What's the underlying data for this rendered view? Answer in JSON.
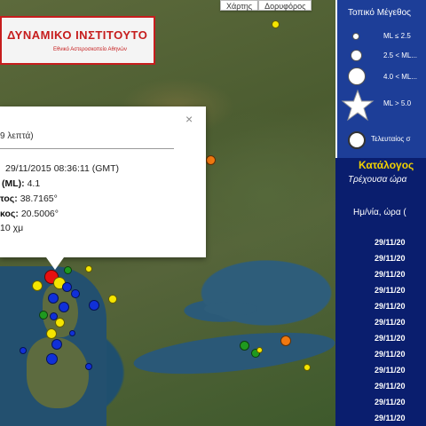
{
  "map": {
    "tabs": [
      {
        "label": "Χάρτης"
      },
      {
        "label": "Δορυφόρος"
      }
    ]
  },
  "logo": {
    "title": "ΔΥΝΑΜΙΚΟ ΙΝΣΤΙΤΟΥΤΟ",
    "subtitle": "Εθνικό Αστεροσκοπείο Αθηνών"
  },
  "popup": {
    "close": "×",
    "ago": "9 λεπτά)",
    "datetime": "29/11/2015  08:36:11 (GMT)",
    "magnitude_label": "(ML):",
    "magnitude_value": "4.1",
    "lat_label": "τος:",
    "lat_value": "38.7165°",
    "lon_label": "κος:",
    "lon_value": "20.5006°",
    "depth": "10 χμ"
  },
  "legend": {
    "title": "Τοπικό Μέγεθος",
    "items": [
      {
        "label": "ML ≤ 2.5"
      },
      {
        "label": "2.5 < ML..."
      },
      {
        "label": "4.0 < ML..."
      },
      {
        "label": "ML > 5.0"
      },
      {
        "label": "Τελευταίος σ"
      }
    ]
  },
  "catalog": {
    "title": "Κατάλογος",
    "subtitle": "Τρέχουσα ώρα",
    "column_header": "Ημ/νία, ώρα (",
    "rows": [
      "29/11/20",
      "29/11/20",
      "29/11/20",
      "29/11/20",
      "29/11/20",
      "29/11/20",
      "29/11/20",
      "29/11/20",
      "29/11/20",
      "29/11/20",
      "29/11/20",
      "29/11/20"
    ]
  },
  "colors": {
    "yellow": "#f5e500",
    "green": "#1f9a1f",
    "blue": "#1030d8",
    "red": "#e81010",
    "orange": "#f07810"
  }
}
